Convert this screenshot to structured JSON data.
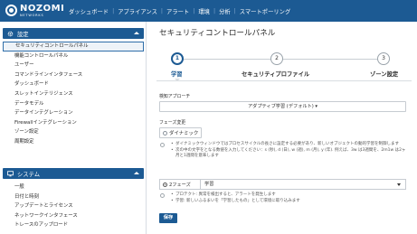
{
  "brand": {
    "name": "NOZOMI",
    "sub": "NETWORKS"
  },
  "topnav": [
    "ダッシュボード",
    "アプライアンス",
    "アラート",
    "環境",
    "分析",
    "スマートポーリング"
  ],
  "sidebar": {
    "settings_header": "設定",
    "settings_items": [
      "セキュリティコントロールパネル",
      "機能コントロールパネル",
      "ユーザー",
      "コマンドラインインタフェース",
      "ダッシュボード",
      "スレットインテリジェンス",
      "データモデル",
      "データインテグレーション",
      "Firewallインテグレーション",
      "ゾーン設定",
      "周期設定"
    ],
    "system_header": "システム",
    "system_items": [
      "一般",
      "日付と時刻",
      "アップデートとライセンス",
      "ネットワークインタフェース",
      "トレースのアップロード"
    ]
  },
  "main": {
    "title": "セキュリティコントロールパネル",
    "steps": [
      {
        "num": "1",
        "label": "学習"
      },
      {
        "num": "2",
        "label": "セキュリティプロファイル"
      },
      {
        "num": "3",
        "label": "ゾーン設定"
      }
    ],
    "detection_label": "検知アプローチ",
    "detection_value": "アダプティブ学習 (デフォルト) ▾",
    "phase_change_label": "フェーズ変更",
    "dynamic_label": "ダイナミック",
    "bullets_1": [
      "ダイナミックウィンドウではプロセスサイクルの長さに設定する必要があり、新しいオブジェクトの動的学習を制御します",
      "次の中の文字をとなる数値を入力してください：s (秒), d (日), w (週), m (月), y (年). 例えば、3w は3週間を、2m1w は2ヶ月と1週間を意味します"
    ],
    "two_phase_label": "2フェーズ",
    "phase_select_value": "学習",
    "bullets_2": [
      "プロテクト: 異常を検出すると、アラートを発生します",
      "学習: 新しいふるまいを「学習したもの」として環境に取り込みます"
    ],
    "save_label": "保存"
  },
  "colors": {
    "accent": "#1c5a93",
    "border": "#c6cbd1"
  }
}
